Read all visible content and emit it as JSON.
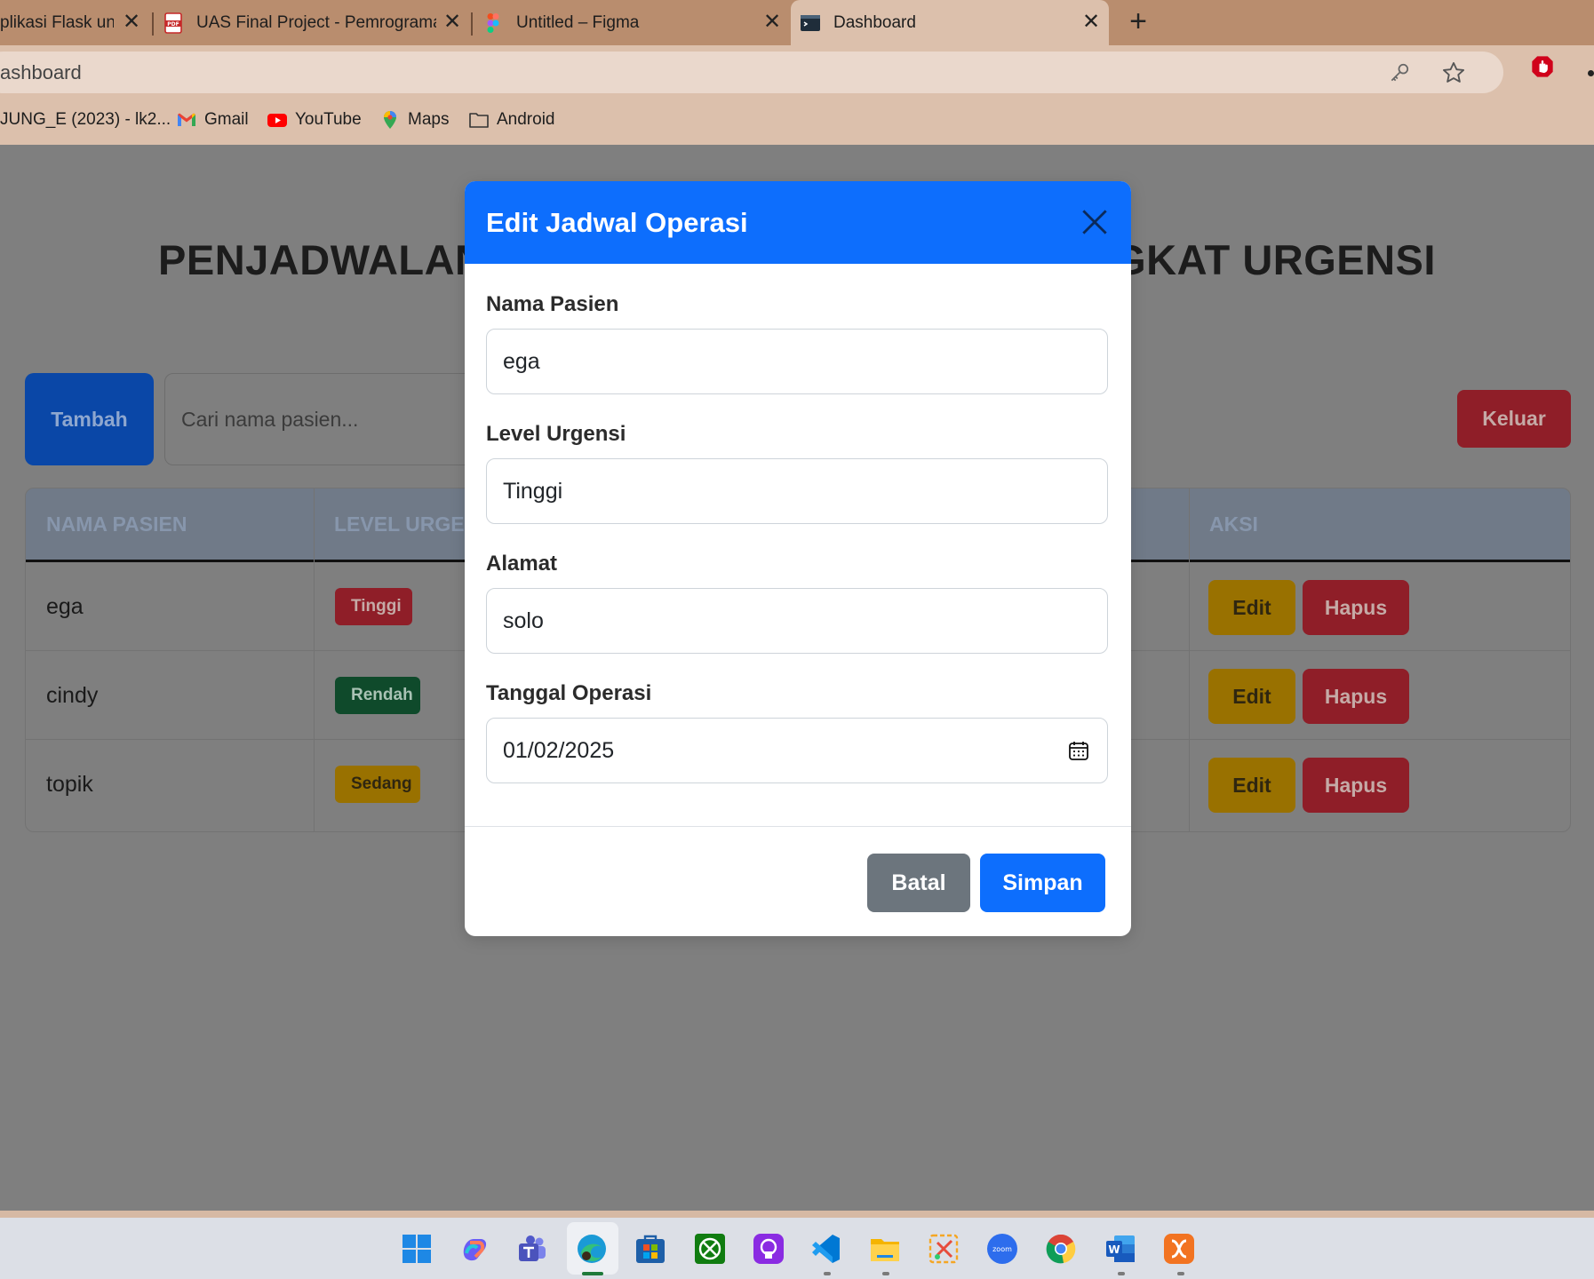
{
  "browser": {
    "tabs": [
      {
        "title": "Aplikasi Flask untuk",
        "visible_title": "plikasi Flask untu"
      },
      {
        "title": "UAS Final Project - Pemrograman"
      },
      {
        "title": "Untitled – Figma"
      },
      {
        "title": "Dashboard"
      }
    ],
    "address": "ashboard",
    "bookmarks": [
      {
        "label": "JUNG_E (2023) - lk2..."
      },
      {
        "label": "Gmail"
      },
      {
        "label": "YouTube"
      },
      {
        "label": "Maps"
      },
      {
        "label": "Android"
      }
    ]
  },
  "page": {
    "title": "PENJADWALAN OPERASI BERDASARKAN TINGKAT URGENSI",
    "add_button": "Tambah",
    "search_placeholder": "Cari nama pasien...",
    "logout_button": "Keluar",
    "table": {
      "headers": {
        "name": "Nama Pasien",
        "level": "Level Urgensi",
        "action": "Aksi"
      },
      "rows": [
        {
          "name": "ega",
          "level": "Tinggi"
        },
        {
          "name": "cindy",
          "level": "Rendah"
        },
        {
          "name": "topik",
          "level": "Sedang"
        }
      ],
      "edit_label": "Edit",
      "delete_label": "Hapus"
    }
  },
  "modal": {
    "title": "Edit Jadwal Operasi",
    "fields": {
      "nama_label": "Nama Pasien",
      "nama_value": "ega",
      "level_label": "Level Urgensi",
      "level_value": "Tinggi",
      "alamat_label": "Alamat",
      "alamat_value": "solo",
      "tanggal_label": "Tanggal Operasi",
      "tanggal_value": "01/02/2025"
    },
    "cancel_button": "Batal",
    "save_button": "Simpan"
  },
  "colors": {
    "primary": "#0d6efd",
    "danger": "#dc3545",
    "warning": "#ffc107",
    "success": "#198754",
    "secondary": "#6c757d"
  }
}
